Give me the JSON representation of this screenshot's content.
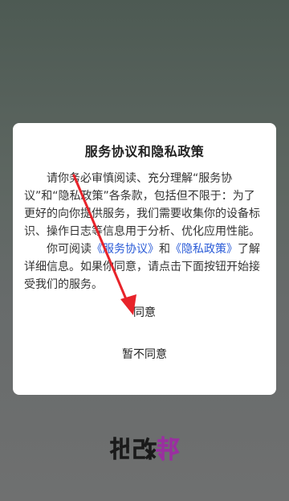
{
  "dialog": {
    "title": "服务协议和隐私政策",
    "paragraph1": "请你务必审慎阅读、充分理解“服务协议”和“隐私政策”各条款，包括但不限于：为了更好的向你提供服务，我们需要收集你的设备标识、操作日志等信息用于分析、优化应用性能。",
    "paragraph2_prefix": "你可阅读",
    "service_link": "《服务协议》",
    "paragraph2_and": "和",
    "privacy_link": "《隐私政策》",
    "paragraph2_suffix": "了解详细信息。如果你同意，请点击下面按钮开始接受我们的服务。",
    "agree_label": "同意",
    "disagree_label": "暂不同意"
  },
  "watermark": {
    "text": "批改邦"
  },
  "colors": {
    "link": "#2a5bd7",
    "arrow": "#e8232a"
  }
}
